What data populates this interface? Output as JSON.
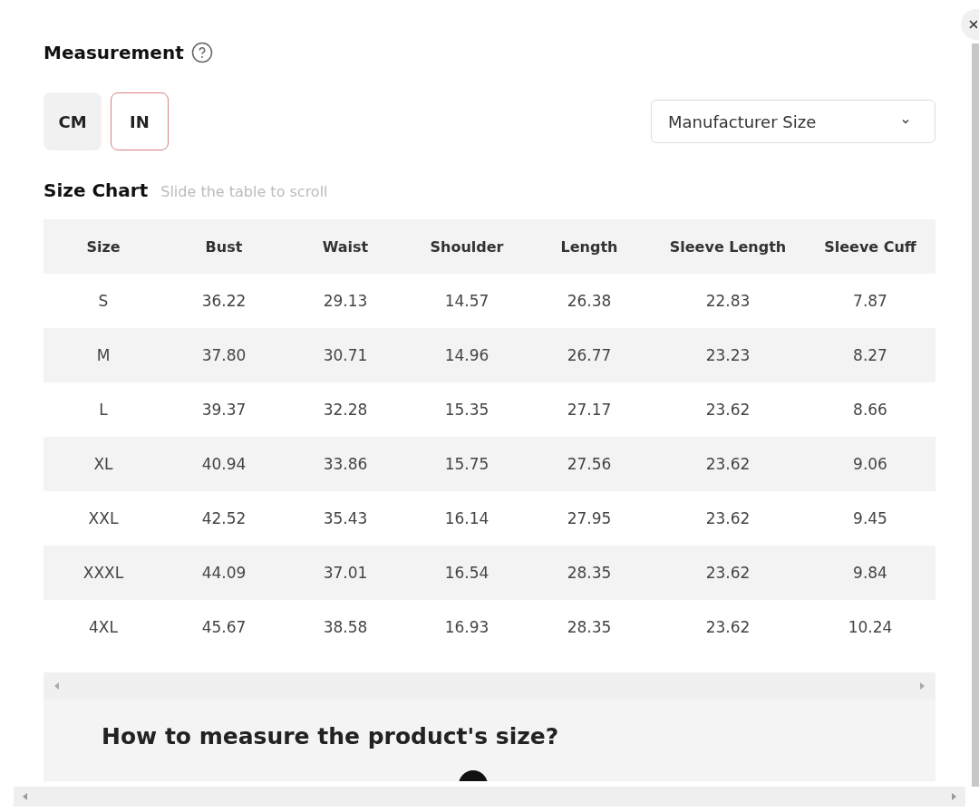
{
  "title": "Measurement",
  "units": [
    {
      "label": "CM",
      "selected": false
    },
    {
      "label": "IN",
      "selected": true
    }
  ],
  "size_select": {
    "value": "Manufacturer Size"
  },
  "size_chart": {
    "title": "Size Chart",
    "hint": "Slide the table to scroll",
    "columns": [
      "Size",
      "Bust",
      "Waist",
      "Shoulder",
      "Length",
      "Sleeve Length",
      "Sleeve Cuff"
    ],
    "rows": [
      [
        "S",
        "36.22",
        "29.13",
        "14.57",
        "26.38",
        "22.83",
        "7.87"
      ],
      [
        "M",
        "37.80",
        "30.71",
        "14.96",
        "26.77",
        "23.23",
        "8.27"
      ],
      [
        "L",
        "39.37",
        "32.28",
        "15.35",
        "27.17",
        "23.62",
        "8.66"
      ],
      [
        "XL",
        "40.94",
        "33.86",
        "15.75",
        "27.56",
        "23.62",
        "9.06"
      ],
      [
        "XXL",
        "42.52",
        "35.43",
        "16.14",
        "27.95",
        "23.62",
        "9.45"
      ],
      [
        "XXXL",
        "44.09",
        "37.01",
        "16.54",
        "28.35",
        "23.62",
        "9.84"
      ],
      [
        "4XL",
        "45.67",
        "38.58",
        "16.93",
        "28.35",
        "23.62",
        "10.24"
      ]
    ]
  },
  "how_to": {
    "heading": "How to measure the product's size?"
  }
}
